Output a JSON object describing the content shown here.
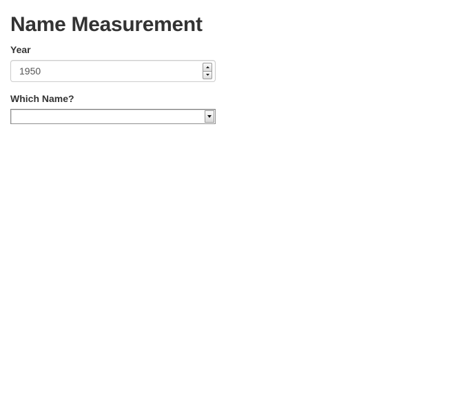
{
  "page": {
    "title": "Name Measurement"
  },
  "year_field": {
    "label": "Year",
    "value": "1950"
  },
  "name_field": {
    "label": "Which Name?",
    "selected_value": ""
  },
  "icons": {
    "spin_up": "spinner-up-arrow-icon",
    "spin_down": "spinner-down-arrow-icon",
    "select_arrow": "chevron-down-icon"
  }
}
